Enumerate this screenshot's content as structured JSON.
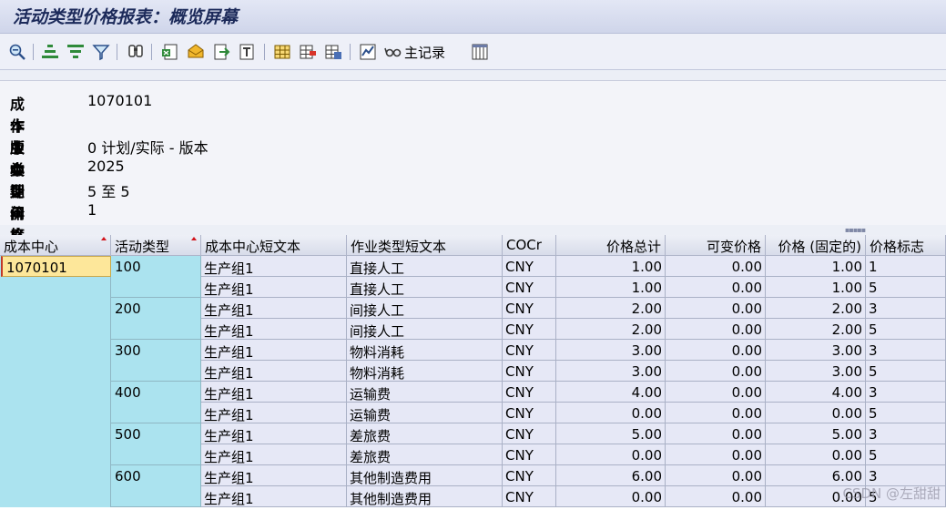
{
  "title": "活动类型价格报表：概览屏幕",
  "toolbar": {
    "master_record_label": "主记录"
  },
  "header": {
    "fields": [
      {
        "label": "成本中心",
        "value": "1070101"
      },
      {
        "label": "作业类型",
        "value": ""
      },
      {
        "label": "版本",
        "value": "0 计划/实际 - 版本"
      },
      {
        "label": "会计年度",
        "value": "2025"
      },
      {
        "label": "期间",
        "value": "5 至 5"
      },
      {
        "label": "价格单位",
        "value": "1"
      }
    ]
  },
  "table": {
    "columns": [
      "成本中心",
      "活动类型",
      "成本中心短文本",
      "作业类型短文本",
      "COCr",
      "价格总计",
      "可变价格",
      "价格 (固定的)",
      "价格标志"
    ],
    "cost_center": "1070101",
    "activity_groups": [
      "100",
      "200",
      "300",
      "400",
      "500",
      "600"
    ],
    "rows": [
      [
        "生产组1",
        "直接人工",
        "CNY",
        "1.00",
        "0.00",
        "1.00",
        "1"
      ],
      [
        "生产组1",
        "直接人工",
        "CNY",
        "1.00",
        "0.00",
        "1.00",
        "5"
      ],
      [
        "生产组1",
        "间接人工",
        "CNY",
        "2.00",
        "0.00",
        "2.00",
        "3"
      ],
      [
        "生产组1",
        "间接人工",
        "CNY",
        "2.00",
        "0.00",
        "2.00",
        "5"
      ],
      [
        "生产组1",
        "物料消耗",
        "CNY",
        "3.00",
        "0.00",
        "3.00",
        "3"
      ],
      [
        "生产组1",
        "物料消耗",
        "CNY",
        "3.00",
        "0.00",
        "3.00",
        "5"
      ],
      [
        "生产组1",
        "运输费",
        "CNY",
        "4.00",
        "0.00",
        "4.00",
        "3"
      ],
      [
        "生产组1",
        "运输费",
        "CNY",
        "0.00",
        "0.00",
        "0.00",
        "5"
      ],
      [
        "生产组1",
        "差旅费",
        "CNY",
        "5.00",
        "0.00",
        "5.00",
        "3"
      ],
      [
        "生产组1",
        "差旅费",
        "CNY",
        "0.00",
        "0.00",
        "0.00",
        "5"
      ],
      [
        "生产组1",
        "其他制造费用",
        "CNY",
        "6.00",
        "0.00",
        "6.00",
        "3"
      ],
      [
        "生产组1",
        "其他制造费用",
        "CNY",
        "0.00",
        "0.00",
        "0.00",
        "5"
      ]
    ]
  },
  "watermark": "CSDN @左甜甜",
  "colors": {
    "key_column_bg": "#abe3ef",
    "selected_cell_bg": "#fde79a",
    "row_bg": "#e6e8f6"
  }
}
